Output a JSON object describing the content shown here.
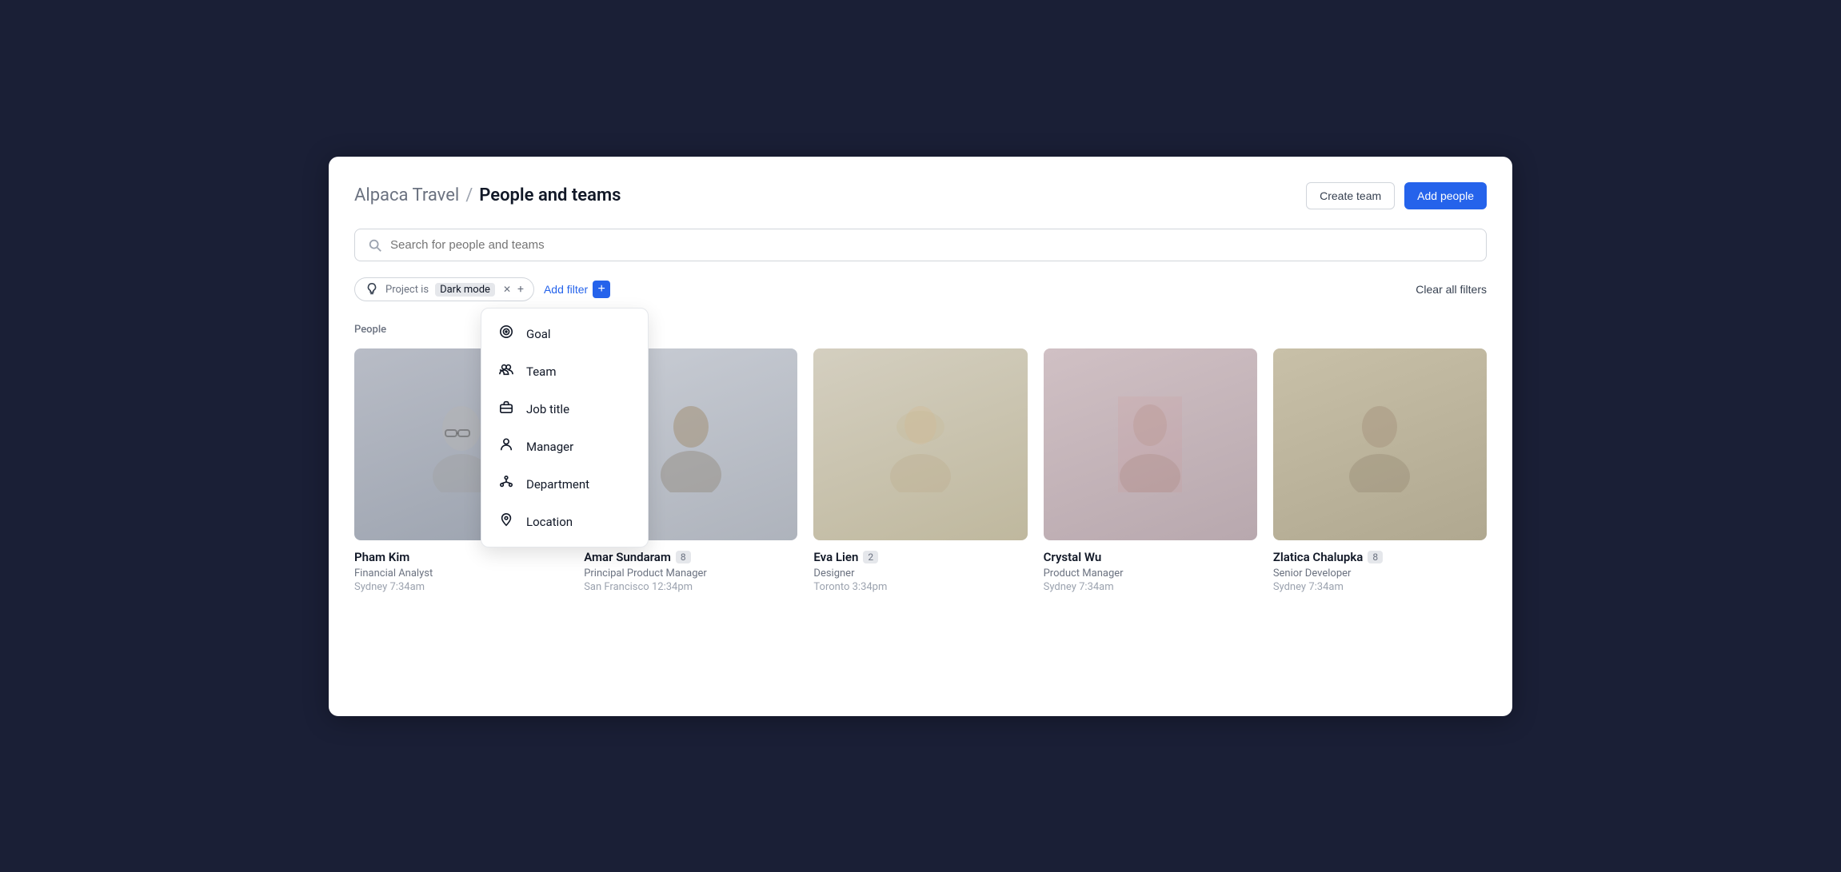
{
  "app": {
    "name": "Alpaca Travel",
    "separator": "/",
    "page_title": "People and teams"
  },
  "header": {
    "create_team_label": "Create team",
    "add_people_label": "Add people"
  },
  "search": {
    "placeholder": "Search for people and teams"
  },
  "filters": {
    "project_is_label": "Project is",
    "project_value": "Dark mode",
    "add_filter_label": "Add filter",
    "clear_all_label": "Clear all filters"
  },
  "dropdown": {
    "items": [
      {
        "label": "Goal",
        "icon": "goal"
      },
      {
        "label": "Team",
        "icon": "team"
      },
      {
        "label": "Job title",
        "icon": "briefcase"
      },
      {
        "label": "Manager",
        "icon": "manager"
      },
      {
        "label": "Department",
        "icon": "department"
      },
      {
        "label": "Location",
        "icon": "location"
      }
    ]
  },
  "people_section_label": "People",
  "people": [
    {
      "name": "Pham Kim",
      "badge": null,
      "role": "Financial Analyst",
      "location": "Sydney",
      "time": "7:34am",
      "avatar_color": "#b0b8c1"
    },
    {
      "name": "Amar Sundaram",
      "badge": "8",
      "role": "Principal Product Manager",
      "location": "San Francisco",
      "time": "12:34pm",
      "avatar_color": "#c5c9ce"
    },
    {
      "name": "Eva Lien",
      "badge": "2",
      "role": "Designer",
      "location": "Toronto",
      "time": "3:34pm",
      "avatar_color": "#d4cfc5"
    },
    {
      "name": "Crystal Wu",
      "badge": null,
      "role": "Product Manager",
      "location": "Sydney",
      "time": "7:34am",
      "avatar_color": "#c8b8bc"
    },
    {
      "name": "Zlatica Chalupka",
      "badge": "8",
      "role": "Senior Developer",
      "location": "Sydney",
      "time": "7:34am",
      "avatar_color": "#c4bca8"
    }
  ],
  "colors": {
    "accent_blue": "#2563eb",
    "border": "#d1d5db",
    "text_muted": "#6b7280"
  }
}
